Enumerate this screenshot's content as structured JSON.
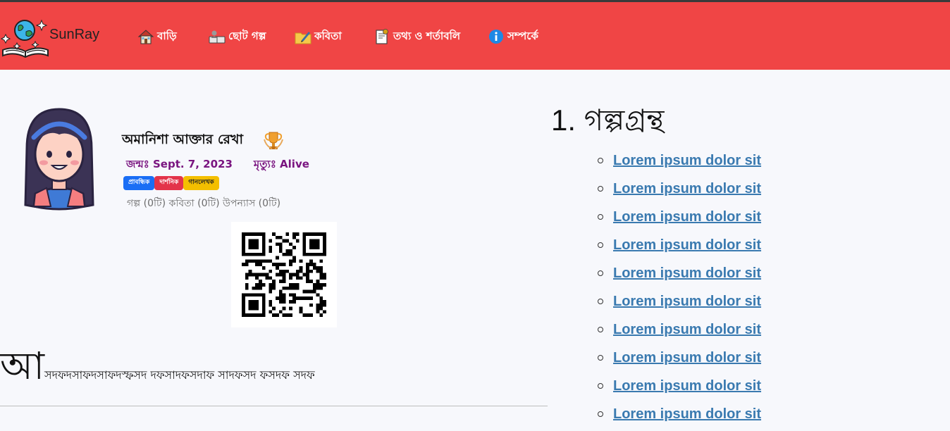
{
  "brand": {
    "name": "SunRay",
    "logo_icon": "globe-book-icon"
  },
  "nav": [
    {
      "label": "বাড়ি",
      "icon": "house-icon"
    },
    {
      "label": "ছোট গল্প",
      "icon": "reading-book-icon"
    },
    {
      "label": "কবিতা",
      "icon": "folder-pen-icon"
    },
    {
      "label": "তথ্য ও শর্তাবলি",
      "icon": "document-icon"
    },
    {
      "label": "সম্পর্কে",
      "icon": "info-icon"
    }
  ],
  "author": {
    "name": "অমানিশা আক্তার রেখা",
    "award_icon": "trophy-icon",
    "birth": "জন্মঃ Sept. 7, 2023",
    "death": "মৃত্যুঃ Alive",
    "tags": [
      {
        "label": "প্রাবন্ধিক",
        "color": "#1a6ef5"
      },
      {
        "label": "দার্শনিক",
        "color": "#e3344a"
      },
      {
        "label": "গানলেখক",
        "color": "#f4bf00"
      }
    ],
    "counts": "গল্প (0টি)  কবিতা (0টি)  উপন্যাস (0টি)"
  },
  "bio": {
    "drop": "আ",
    "text": "সদফদসাফদসাফদস্ফসদ দফসাদফসদাফ সাদফসদ ফসদফ সদফ"
  },
  "books_section": {
    "title": "1.  গল্পগ্রন্থ",
    "items": [
      "Lorem ipsum dolor sit",
      "Lorem ipsum dolor sit",
      "Lorem ipsum dolor sit",
      "Lorem ipsum dolor sit",
      "Lorem ipsum dolor sit",
      "Lorem ipsum dolor sit",
      "Lorem ipsum dolor sit",
      "Lorem ipsum dolor sit",
      "Lorem ipsum dolor sit",
      "Lorem ipsum dolor sit"
    ]
  },
  "colors": {
    "navbar": "#f04545",
    "link": "#3a7ab0",
    "date_text": "#7a1580"
  }
}
